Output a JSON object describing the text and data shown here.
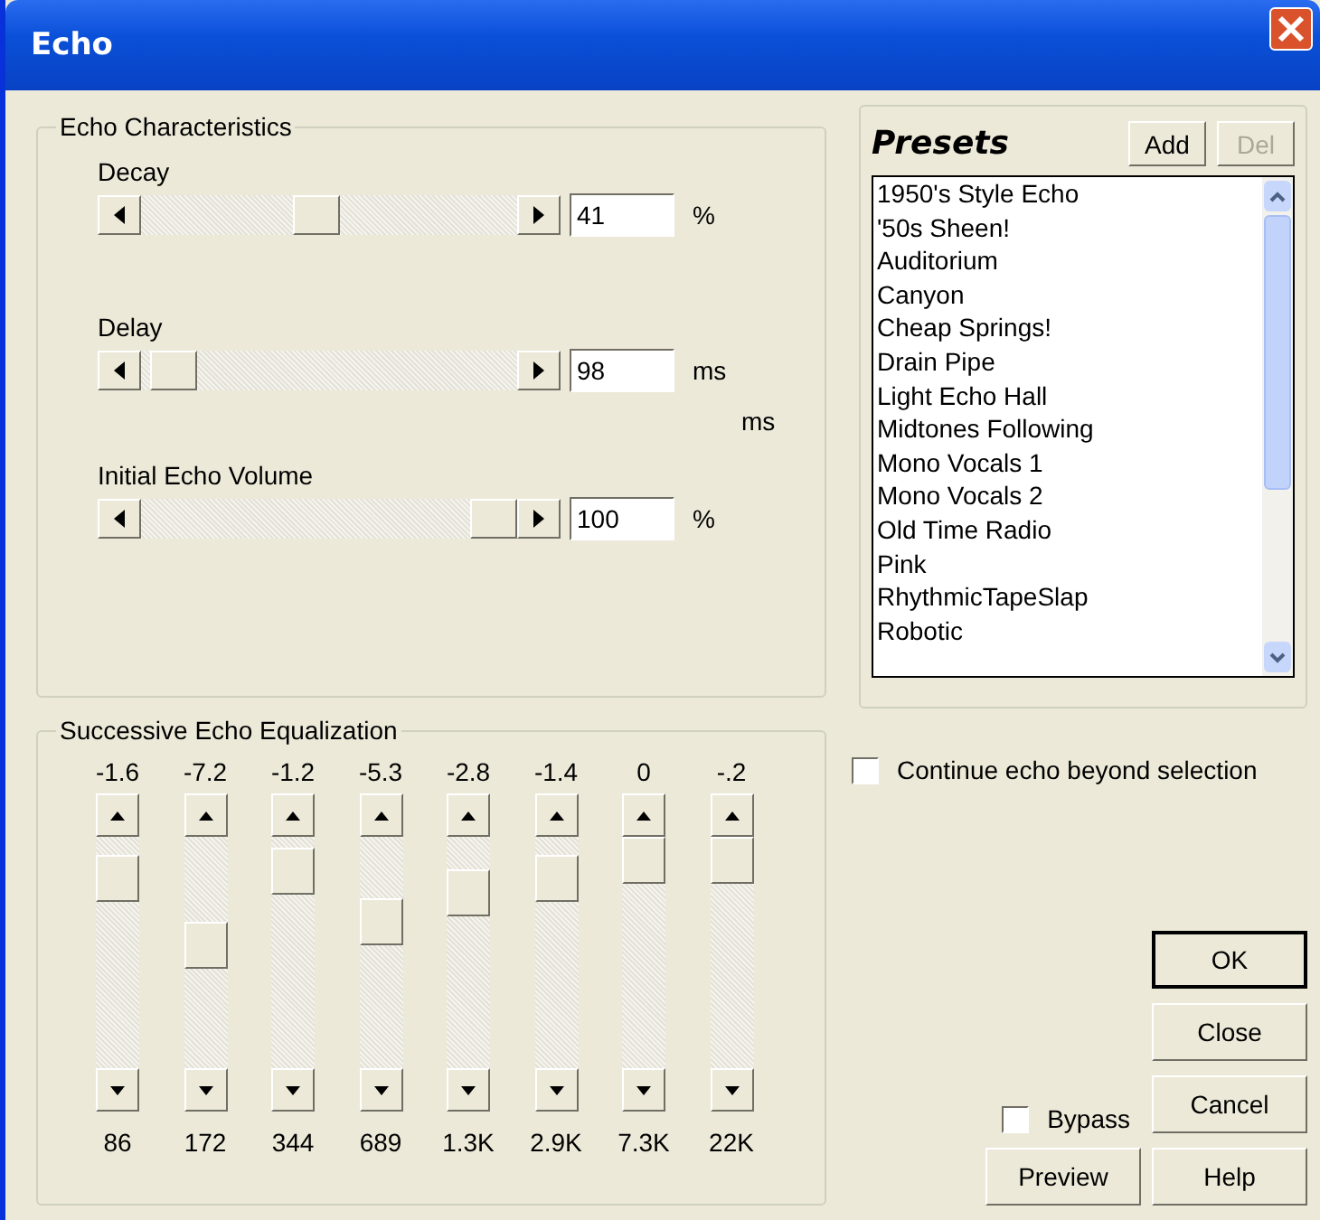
{
  "window": {
    "title": "Echo"
  },
  "characteristics": {
    "title": "Echo Characteristics",
    "sliders": [
      {
        "label": "Decay",
        "level": 0.46,
        "value": "41",
        "unit": "%"
      },
      {
        "label": "Delay",
        "level": 0.03,
        "value": "98",
        "unit": "ms"
      },
      {
        "label": "Initial Echo Volume",
        "level": 1,
        "value": "100",
        "unit": "%"
      }
    ],
    "extra_unit": "ms"
  },
  "presets": {
    "title": "Presets",
    "add": {
      "label": "Add",
      "disabled": false
    },
    "del": {
      "label": "Del",
      "disabled": true
    },
    "items": [
      "1950's Style Echo",
      "'50s Sheen!",
      "Auditorium",
      "Canyon",
      "Cheap Springs!",
      "Drain Pipe",
      "Light Echo Hall",
      "Midtones Following",
      "Mono Vocals 1",
      "Mono Vocals 2",
      "Old Time Radio",
      "Pink",
      "RhythmicTapeSlap",
      "Robotic"
    ]
  },
  "continue_checkbox": {
    "label": "Continue echo beyond selection",
    "checked": false
  },
  "equalization": {
    "title": "Successive Echo Equalization",
    "bands": [
      {
        "value": "-1.6",
        "freq": "86",
        "level": 0.9
      },
      {
        "value": "-7.2",
        "freq": "172",
        "level": 0.54
      },
      {
        "value": "-1.2",
        "freq": "344",
        "level": 0.94
      },
      {
        "value": "-5.3",
        "freq": "689",
        "level": 0.67
      },
      {
        "value": "-2.8",
        "freq": "1.3K",
        "level": 0.82
      },
      {
        "value": "-1.4",
        "freq": "2.9K",
        "level": 0.9
      },
      {
        "value": "0",
        "freq": "7.3K",
        "level": 1
      },
      {
        "value": "-.2",
        "freq": "22K",
        "level": 1
      }
    ]
  },
  "bypass_checkbox": {
    "label": "Bypass",
    "checked": false
  },
  "buttons": {
    "ok": "OK",
    "close": "Close",
    "cancel": "Cancel",
    "preview": "Preview",
    "help": "Help"
  }
}
